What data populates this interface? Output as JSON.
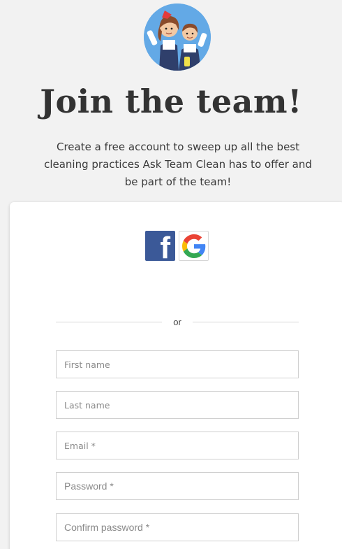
{
  "header": {
    "avatar_icon": "team-clean-mascots-icon",
    "title": "Join the team!",
    "subtitle": "Create a free account to sweep up all the best cleaning practices Ask Team Clean has to offer and be part of the team!"
  },
  "social": {
    "facebook_icon": "facebook-icon",
    "facebook_letter": "f",
    "facebook_color": "#3b5998",
    "google_icon": "google-icon"
  },
  "divider": {
    "label": "or"
  },
  "form": {
    "first_name": {
      "placeholder": "First name",
      "value": ""
    },
    "last_name": {
      "placeholder": "Last name",
      "value": ""
    },
    "email": {
      "placeholder": "Email *",
      "value": ""
    },
    "password": {
      "placeholder": "Password *",
      "value": ""
    },
    "confirm_password": {
      "placeholder": "Confirm password *",
      "value": ""
    }
  },
  "colors": {
    "background": "#f2f2f2",
    "card": "#ffffff",
    "title": "#333333",
    "avatar_bg": "#63a9e6"
  }
}
